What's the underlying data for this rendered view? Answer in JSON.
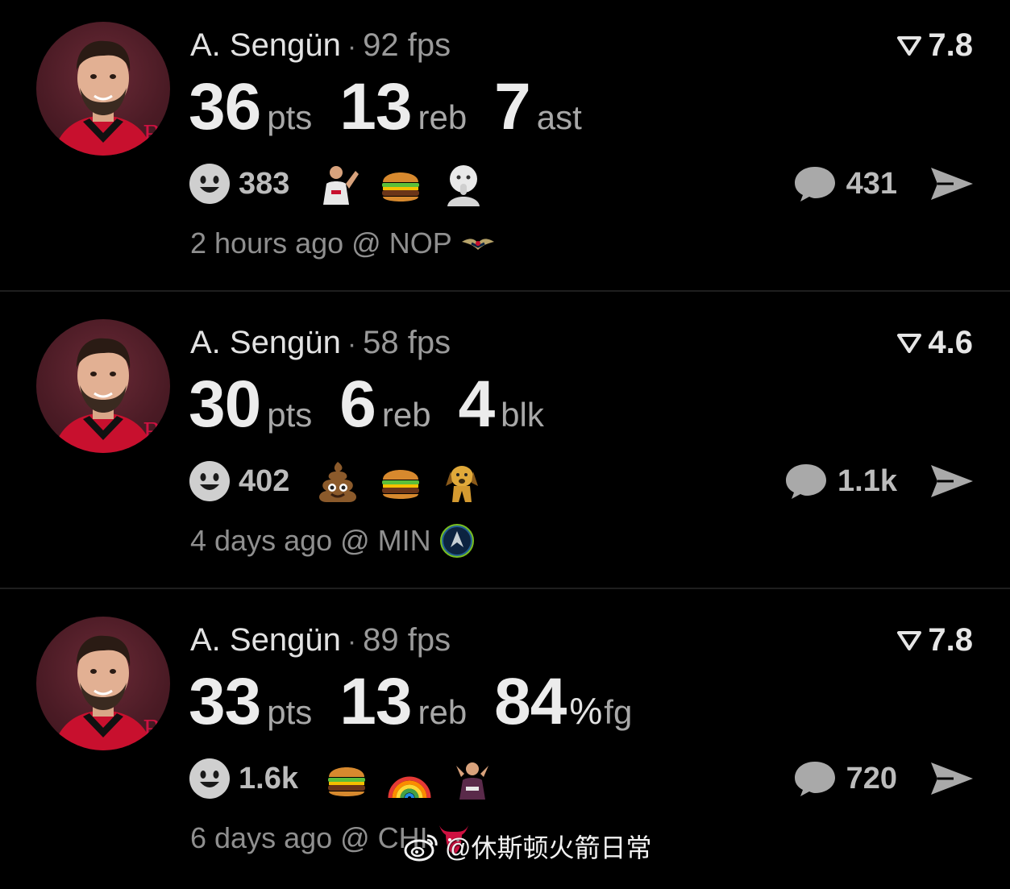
{
  "posts": [
    {
      "player": "A. Sengün",
      "separator": "·",
      "fps": "92 fps",
      "rating": "7.8",
      "stats": [
        {
          "value": "36",
          "unit": "pts"
        },
        {
          "value": "13",
          "unit": "reb"
        },
        {
          "value": "7",
          "unit": "ast"
        }
      ],
      "reaction_count": "383",
      "emojis": [
        "player-photo-emoji",
        "burger-emoji",
        "thinking-face-emoji"
      ],
      "comment_count": "431",
      "time": "2 hours ago @ NOP",
      "team_logo": "pelicans-logo-icon"
    },
    {
      "player": "A. Sengün",
      "separator": "·",
      "fps": "58 fps",
      "rating": "4.6",
      "stats": [
        {
          "value": "30",
          "unit": "pts"
        },
        {
          "value": "6",
          "unit": "reb"
        },
        {
          "value": "4",
          "unit": "blk"
        }
      ],
      "reaction_count": "402",
      "emojis": [
        "poop-emoji",
        "burger-emoji",
        "dog-emoji"
      ],
      "comment_count": "1.1k",
      "time": "4 days ago @ MIN",
      "team_logo": "timberwolves-logo-icon"
    },
    {
      "player": "A. Sengün",
      "separator": "·",
      "fps": "89 fps",
      "rating": "7.8",
      "stats": [
        {
          "value": "33",
          "unit": "pts"
        },
        {
          "value": "13",
          "unit": "reb"
        },
        {
          "value": "84",
          "pct": "%",
          "unit": "fg"
        }
      ],
      "reaction_count": "1.6k",
      "emojis": [
        "burger-emoji",
        "rainbow-emoji",
        "player-photo-emoji"
      ],
      "comment_count": "720",
      "time": "6 days ago @ CHI",
      "team_logo": "bulls-logo-icon"
    }
  ],
  "watermark": "@休斯顿火箭日常",
  "colors": {
    "background": "#000000",
    "text_primary": "#ececec",
    "text_secondary": "#8f8f8f",
    "avatar_bg": "#4b1b25",
    "rockets_red": "#ce1141"
  }
}
